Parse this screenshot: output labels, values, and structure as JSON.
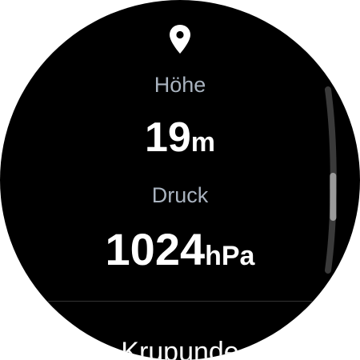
{
  "location": {
    "icon": "location-pin-icon"
  },
  "altitude": {
    "label": "Höhe",
    "value": "19",
    "unit": "m"
  },
  "pressure": {
    "label": "Druck",
    "value": "1024",
    "unit": "hPa"
  },
  "next_item": {
    "label": "Krupunde"
  },
  "scroll": {
    "icon": "scroll-indicator",
    "position": 0.55
  },
  "colors": {
    "background": "#000000",
    "label": "#a9b3bf",
    "value": "#ffffff",
    "scroll_track": "#3a3a3a",
    "scroll_thumb": "#9a9a9a"
  }
}
